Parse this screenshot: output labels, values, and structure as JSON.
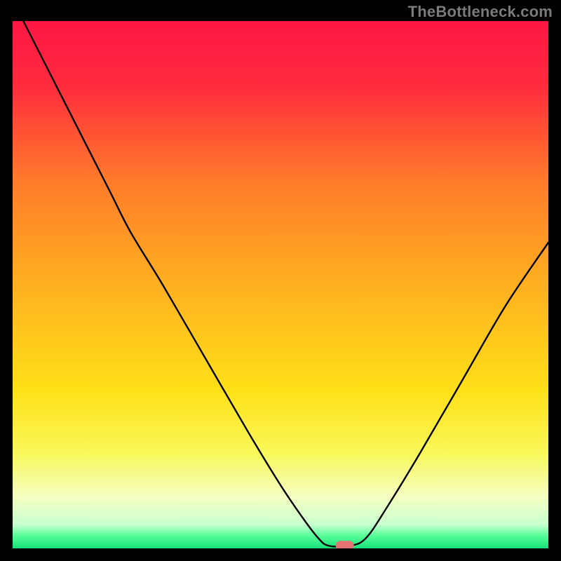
{
  "watermark": "TheBottleneck.com",
  "chart_data": {
    "type": "line",
    "title": "",
    "xlabel": "",
    "ylabel": "",
    "legend": false,
    "grid": false,
    "xlim": [
      0,
      100
    ],
    "ylim": [
      0,
      100
    ],
    "y_reference_ratio": 0.605,
    "background": {
      "description": "vertical rainbow gradient with thick green band at bottom",
      "stops": [
        {
          "offset": 0.0,
          "color": "#ff1744"
        },
        {
          "offset": 0.12,
          "color": "#ff2a3e"
        },
        {
          "offset": 0.3,
          "color": "#ff7a2a"
        },
        {
          "offset": 0.5,
          "color": "#ffb020"
        },
        {
          "offset": 0.7,
          "color": "#ffe018"
        },
        {
          "offset": 0.82,
          "color": "#f8f85a"
        },
        {
          "offset": 0.9,
          "color": "#f5ffc0"
        },
        {
          "offset": 0.955,
          "color": "#c8ffd0"
        },
        {
          "offset": 0.975,
          "color": "#5aff9a"
        },
        {
          "offset": 1.0,
          "color": "#16e07a"
        }
      ]
    },
    "series": [
      {
        "name": "bottleneck-curve",
        "stroke": "#000000",
        "data": [
          {
            "x": 2,
            "y": 100
          },
          {
            "x": 10,
            "y": 84
          },
          {
            "x": 18,
            "y": 68
          },
          {
            "x": 22,
            "y": 60
          },
          {
            "x": 28,
            "y": 50
          },
          {
            "x": 36,
            "y": 36
          },
          {
            "x": 44,
            "y": 22
          },
          {
            "x": 50,
            "y": 12
          },
          {
            "x": 54,
            "y": 6
          },
          {
            "x": 57,
            "y": 2
          },
          {
            "x": 59,
            "y": 0.5
          },
          {
            "x": 63,
            "y": 0.5
          },
          {
            "x": 66,
            "y": 2
          },
          {
            "x": 70,
            "y": 8
          },
          {
            "x": 76,
            "y": 18
          },
          {
            "x": 84,
            "y": 32
          },
          {
            "x": 92,
            "y": 46
          },
          {
            "x": 100,
            "y": 58
          }
        ]
      }
    ],
    "marker": {
      "name": "your-hardware-marker",
      "x": 62,
      "y": 0.5,
      "color": "#e57373",
      "shape": "rounded-pill"
    }
  }
}
